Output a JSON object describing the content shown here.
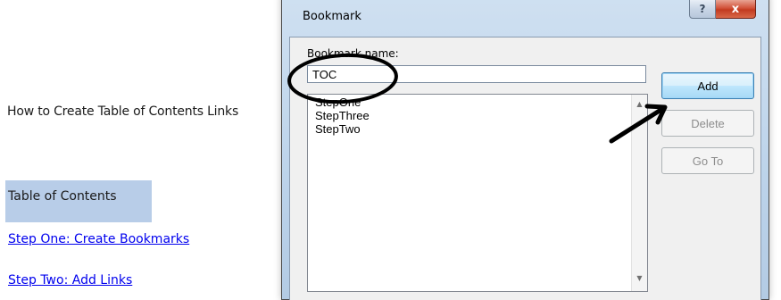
{
  "document": {
    "heading": "How to Create Table of Contents Links",
    "toc_title": "Table of Contents",
    "links": [
      {
        "label": "Step One: Create Bookmarks"
      },
      {
        "label": "Step Two: Add Links"
      }
    ],
    "toc_highlight_color": "#b8cde8",
    "link_color": "#0000ee"
  },
  "dialog": {
    "title": "Bookmark",
    "help_symbol": "?",
    "close_symbol": "x",
    "field_label": "Bookmark name:",
    "name_value": "TOC",
    "bookmarks": [
      "StepOne",
      "StepThree",
      "StepTwo"
    ],
    "buttons": {
      "add": "Add",
      "delete": "Delete",
      "goto": "Go To"
    },
    "scroll_up_icon": "▲",
    "scroll_down_icon": "▼"
  },
  "annotations": {
    "circle_color": "#000000",
    "arrow_color": "#000000"
  }
}
